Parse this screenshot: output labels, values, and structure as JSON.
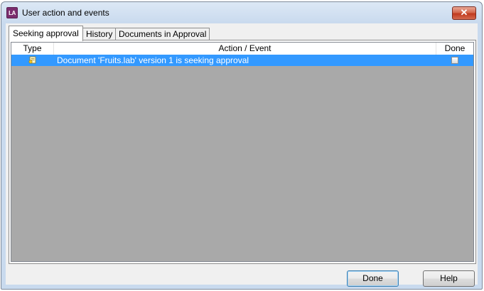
{
  "window": {
    "title": "User action and events",
    "app_icon_text": "LA",
    "close_glyph": "✕"
  },
  "tabs": [
    {
      "label": "Seeking approval",
      "active": true
    },
    {
      "label": "History",
      "active": false
    },
    {
      "label": "Documents in Approval",
      "active": false
    }
  ],
  "table": {
    "columns": [
      "Type",
      "Action / Event",
      "Done"
    ],
    "rows": [
      {
        "type_icon": "document-approval-icon",
        "action": "Document 'Fruits.lab' version 1 is seeking approval",
        "done": false,
        "selected": true
      }
    ]
  },
  "buttons": {
    "done_label": "Done",
    "help_label": "Help"
  },
  "colors": {
    "selection": "#3399ff",
    "empty_list_bg": "#a9a9a9",
    "close_button": "#c0391e"
  }
}
